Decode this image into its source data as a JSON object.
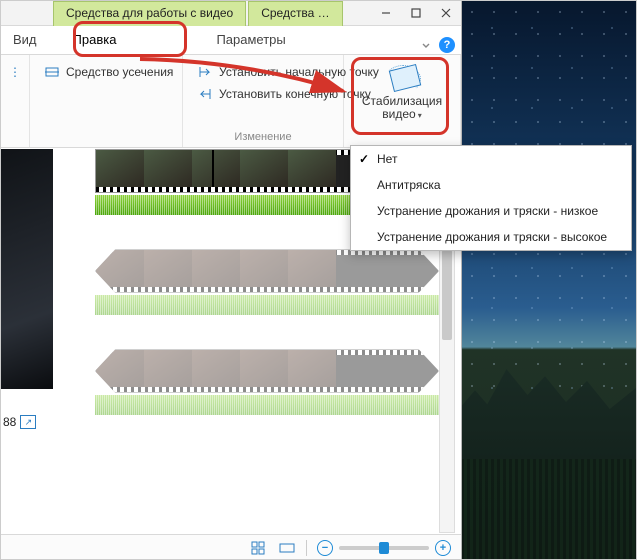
{
  "context_tabs": [
    "Средства для работы с видео",
    "Средства …"
  ],
  "tabs": [
    "Вид",
    "Правка",
    "Параметры"
  ],
  "help_glyph": "?",
  "ribbon": {
    "trim": "Средство усечения",
    "set_start": "Установить начальную точку",
    "set_end": "Установить конечную точку",
    "group_edit": "Изменение",
    "stabilize": "Стабилизация видео"
  },
  "menu": [
    "Нет",
    "Антитряска",
    "Устранение дрожания и тряски - низкое",
    "Устранение дрожания и тряски - высокое"
  ],
  "status": {
    "time": "88"
  },
  "colors": {
    "callout": "#d4342a",
    "accent": "#1e8bd6",
    "context_tab_bg": "#d2e89c"
  }
}
